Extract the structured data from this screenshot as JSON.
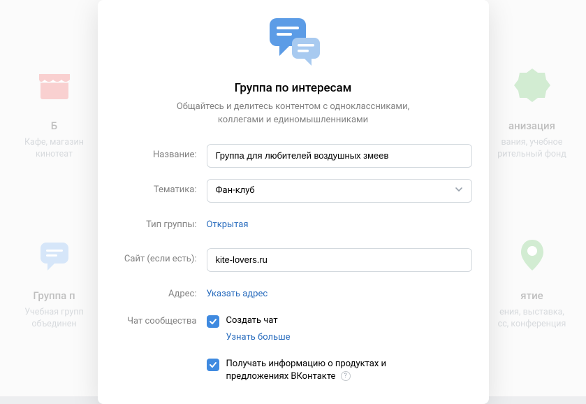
{
  "background": {
    "cards": [
      {
        "title_fragment": "Б",
        "subtitle": "Кафе, магазин\nкинотеат"
      },
      {
        "title_fragment": "анизация",
        "subtitle": "вания, учебное\nрительный фонд"
      },
      {
        "title_fragment": "Группа п",
        "subtitle": "Учебная групп\nобъединен"
      },
      {
        "title_fragment": "ятие",
        "subtitle": "ения, выставка,\nсс, конференция"
      }
    ]
  },
  "modal": {
    "title": "Группа по интересам",
    "subtitle": "Общайтесь и делитесь контентом с одноклассниками, коллегами и единомышленниками"
  },
  "form": {
    "name_label": "Название:",
    "name_value": "Группа для любителей воздушных змеев",
    "topic_label": "Тематика:",
    "topic_value": "Фан-клуб",
    "type_label": "Тип группы:",
    "type_value": "Открытая",
    "site_label": "Сайт (если есть):",
    "site_value": "kite-lovers.ru",
    "address_label": "Адрес:",
    "address_value": "Указать адрес",
    "chat_label": "Чат сообщества",
    "chat_checkbox": "Создать чат",
    "learn_more": "Узнать больше",
    "marketing_checkbox": "Получать информацию о продуктах и предложениях ВКонтакте"
  }
}
